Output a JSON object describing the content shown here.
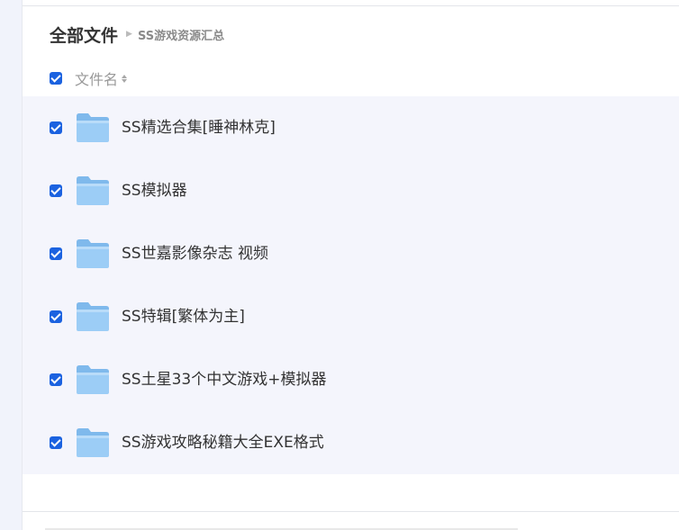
{
  "breadcrumb": {
    "root": "全部文件",
    "current": "SS游戏资源汇总"
  },
  "list_header": {
    "column_label": "文件名",
    "select_all_checked": true
  },
  "colors": {
    "accent": "#1b62e0",
    "panel_bg": "#f4f5fc",
    "folder": "#8cc4f2"
  },
  "files": [
    {
      "name": "SS精选合集[睡神林克]",
      "type": "folder",
      "checked": true
    },
    {
      "name": "SS模拟器",
      "type": "folder",
      "checked": true
    },
    {
      "name": "SS世嘉影像杂志 视频",
      "type": "folder",
      "checked": true
    },
    {
      "name": "SS特辑[繁体为主]",
      "type": "folder",
      "checked": true
    },
    {
      "name": "SS土星33个中文游戏+模拟器",
      "type": "folder",
      "checked": true
    },
    {
      "name": "SS游戏攻略秘籍大全EXE格式",
      "type": "folder",
      "checked": true
    }
  ]
}
